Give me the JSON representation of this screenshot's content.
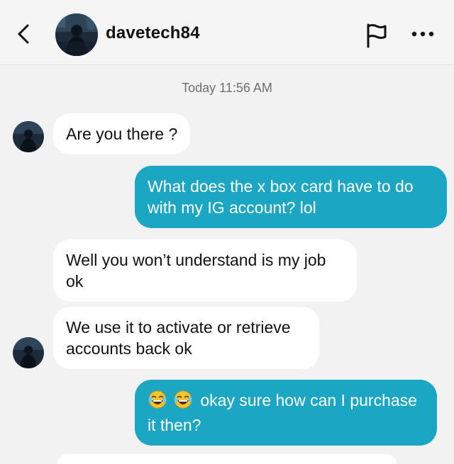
{
  "header": {
    "username": "davetech84",
    "back_icon": "chevron-left-icon",
    "flag_icon": "flag-icon",
    "more_icon": "more-horizontal-icon"
  },
  "thread": {
    "timestamp": "Today 11:56 AM",
    "messages": [
      {
        "direction": "incoming",
        "text": "Are you there ?"
      },
      {
        "direction": "outgoing",
        "text": "What does the x box card have to do with my IG account? lol"
      },
      {
        "direction": "incoming",
        "text": "Well you won’t understand is my job ok"
      },
      {
        "direction": "incoming",
        "text": "We use it to activate or retrieve accounts back ok"
      },
      {
        "direction": "outgoing",
        "emoji": "😂😂",
        "text": "okay sure how can I purchase it then?"
      }
    ]
  },
  "colors": {
    "outgoing_bubble": "#1ba7c4",
    "incoming_bubble": "#ffffff",
    "background": "#f2f2f2"
  }
}
